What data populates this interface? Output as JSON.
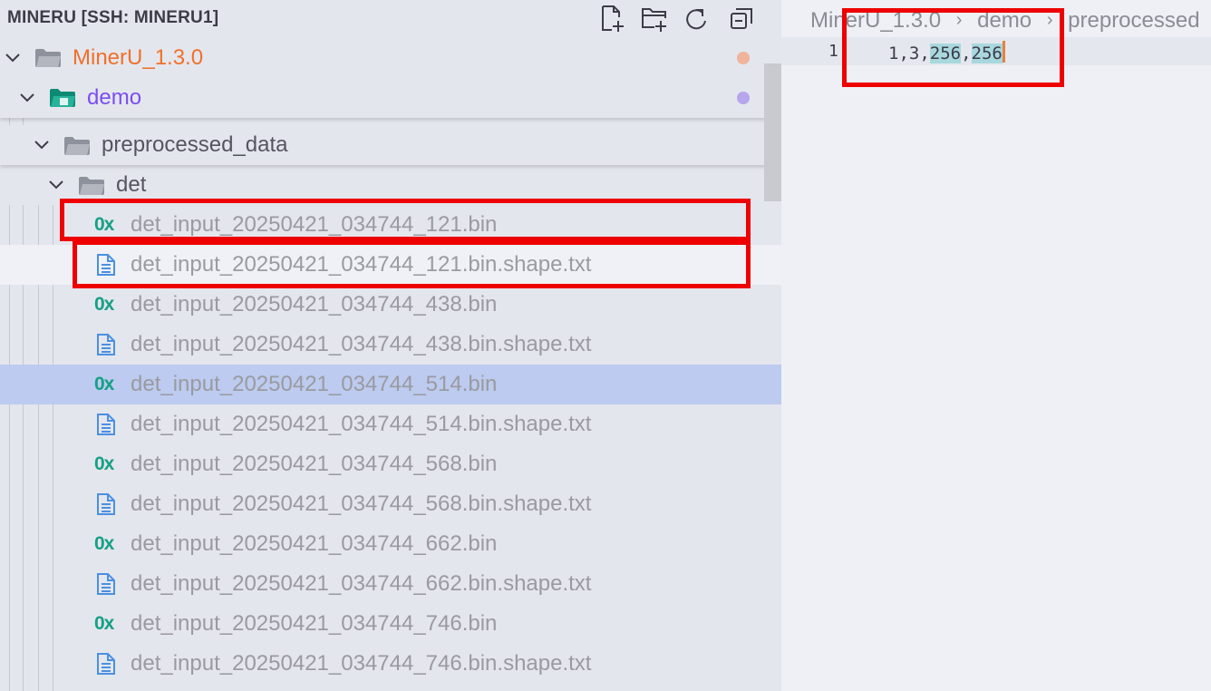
{
  "explorer": {
    "title": "MINERU [SSH: MINERU1]",
    "actions": [
      {
        "name": "new-file-button",
        "icon": "new-file-icon"
      },
      {
        "name": "new-folder-button",
        "icon": "new-folder-icon"
      },
      {
        "name": "refresh-button",
        "icon": "refresh-icon"
      },
      {
        "name": "collapse-all-button",
        "icon": "collapse-all-icon"
      }
    ],
    "folders": [
      {
        "label": "MinerU_1.3.0",
        "color": "#f0702a",
        "dot_color": "#f0b49a"
      },
      {
        "label": "demo",
        "color": "#7b4df2",
        "dot_color": "#b7a6ec"
      },
      {
        "label": "preprocessed_data",
        "color": "#555560"
      },
      {
        "label": "det",
        "color": "#555560"
      }
    ],
    "files": [
      {
        "label": "det_input_20250421_034744_121.bin",
        "type": "bin"
      },
      {
        "label": "det_input_20250421_034744_121.bin.shape.txt",
        "type": "txt"
      },
      {
        "label": "det_input_20250421_034744_438.bin",
        "type": "bin"
      },
      {
        "label": "det_input_20250421_034744_438.bin.shape.txt",
        "type": "txt"
      },
      {
        "label": "det_input_20250421_034744_514.bin",
        "type": "bin"
      },
      {
        "label": "det_input_20250421_034744_514.bin.shape.txt",
        "type": "txt"
      },
      {
        "label": "det_input_20250421_034744_568.bin",
        "type": "bin"
      },
      {
        "label": "det_input_20250421_034744_568.bin.shape.txt",
        "type": "txt"
      },
      {
        "label": "det_input_20250421_034744_662.bin",
        "type": "bin"
      },
      {
        "label": "det_input_20250421_034744_662.bin.shape.txt",
        "type": "txt"
      },
      {
        "label": "det_input_20250421_034744_746.bin",
        "type": "bin"
      },
      {
        "label": "det_input_20250421_034744_746.bin.shape.txt",
        "type": "txt"
      }
    ],
    "bin_icon_text": "0x",
    "bin_icon_color": "#16a085",
    "txt_icon_color": "#4a90e2"
  },
  "editor": {
    "breadcrumb": [
      "MinerU_1.3.0",
      "demo",
      "preprocessed"
    ],
    "line_number": "1",
    "code": {
      "part1": "1,3,",
      "hl1": "256",
      "comma": ",",
      "hl2": "256"
    }
  }
}
